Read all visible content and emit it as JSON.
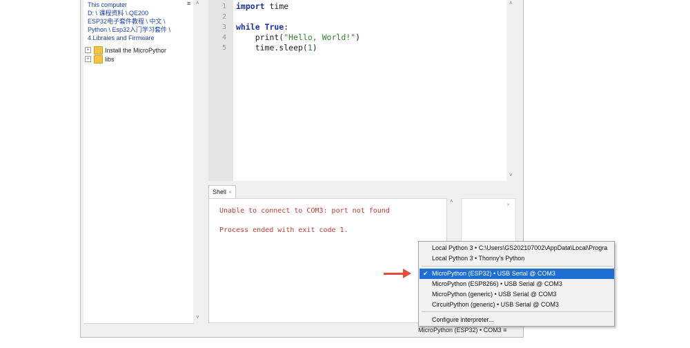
{
  "files": {
    "menu_glyph": "≡",
    "path_lines": [
      "This computer",
      "D: \\ 课程资料 \\ QE200",
      "ESP32电子套件教程 \\ 中文 \\",
      "Python \\ Esp32入门学习套件 \\",
      "4.Libraies and Firmware"
    ],
    "tree": [
      {
        "expander": "+",
        "label": "Install the MicroPythor"
      },
      {
        "expander": "+",
        "label": "libs"
      }
    ]
  },
  "editor": {
    "line_numbers": [
      "1",
      "2",
      "3",
      "4",
      "5"
    ]
  },
  "shell": {
    "tab_label": "Shell",
    "tab_close": "×",
    "lines": [
      "Unable to connect to COM3: port not found",
      "Process ended with exit code 1."
    ],
    "side_close": "×"
  },
  "interpreter_menu": {
    "items": [
      {
        "label": "Local Python 3  •  C:\\Users\\GS202107002\\AppData\\Local\\Progra",
        "selected": false
      },
      {
        "label": "Local Python 3  •  Thonny's Python",
        "selected": false
      },
      {
        "label": "MicroPython (ESP32)  •  USB Serial @ COM3",
        "selected": true,
        "check": "✔"
      },
      {
        "label": "MicroPython (ESP8266)  •  USB Serial @ COM3",
        "selected": false
      },
      {
        "label": "MicroPython (generic)  •  USB Serial @ COM3",
        "selected": false
      },
      {
        "label": "CircuitPython (generic)  •  USB Serial @ COM3",
        "selected": false
      },
      {
        "label": "Configure interpreter...",
        "selected": false
      }
    ]
  },
  "status_bar": {
    "interpreter": "MicroPython (ESP32)  •  COM3  ≡"
  },
  "colors": {
    "accent_selection": "#1f6ed4",
    "error_text": "#c0392b",
    "arrow": "#e84a3c"
  }
}
